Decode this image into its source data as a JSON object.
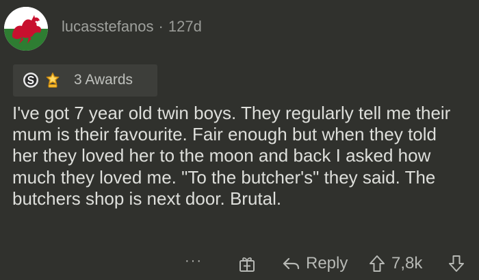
{
  "comment": {
    "username": "lucasstefanos",
    "separator": "·",
    "age": "127d",
    "awards_label": "3 Awards",
    "body": "I've got 7 year old twin boys. They regularly tell me their mum is their favourite. Fair enough but when they told her they loved her to the moon and back I asked how much they loved me. \"To the butcher's\" they said. The butchers shop is next door. Brutal.",
    "actions": {
      "more": "···",
      "reply": "Reply",
      "score": "7,8k"
    }
  },
  "icons": {
    "avatar": "welsh-dragon-avatar",
    "award_1": "silver-award-icon",
    "award_2": "helpful-star-award-icon",
    "gift": "gift-icon",
    "reply": "reply-arrow-icon",
    "upvote": "upvote-arrow-icon",
    "downvote": "downvote-arrow-icon"
  },
  "colors": {
    "background": "#30312d",
    "award_pill": "#3d3e3a",
    "dragon_red": "#c8102e",
    "flag_green": "#2e7d32",
    "star_gold": "#f5b82e"
  }
}
